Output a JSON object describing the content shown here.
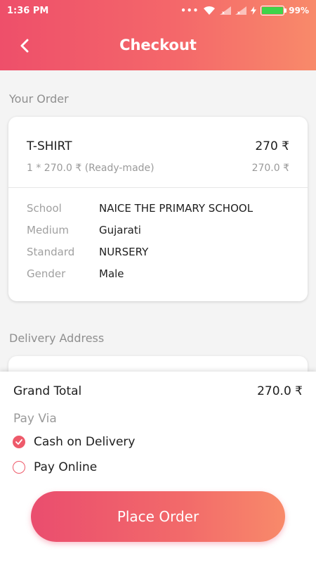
{
  "status_bar": {
    "time": "1:36 PM",
    "battery": "99%",
    "battery_level": 0.99
  },
  "header": {
    "title": "Checkout",
    "back_icon": "chevron-left-icon",
    "gradient": [
      "#ee4f6a",
      "#f88a6a"
    ]
  },
  "order": {
    "section_label": "Your Order",
    "item": {
      "name": "T-SHIRT",
      "price": "270 ₹",
      "qty_line": "1 * 270.0 ₹ (Ready-made)",
      "subtotal": "270.0 ₹"
    },
    "details": [
      {
        "key": "School",
        "value": "NAICE THE PRIMARY SCHOOL"
      },
      {
        "key": "Medium",
        "value": "Gujarati"
      },
      {
        "key": "Standard",
        "value": "NURSERY"
      },
      {
        "key": "Gender",
        "value": "Male"
      }
    ]
  },
  "delivery": {
    "section_label": "Delivery Address"
  },
  "summary": {
    "grand_total_label": "Grand Total",
    "grand_total_value": "270.0 ₹",
    "pay_via_label": "Pay Via",
    "payment_options": [
      {
        "label": "Cash on Delivery",
        "selected": true
      },
      {
        "label": "Pay Online",
        "selected": false
      }
    ],
    "place_order_label": "Place Order",
    "accent": "#ee5a6a"
  }
}
